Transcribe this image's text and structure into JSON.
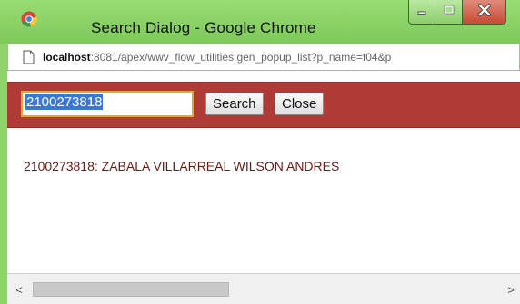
{
  "window": {
    "title": "Search Dialog - Google Chrome",
    "icon": "chrome-icon",
    "controls": {
      "minimize": "minimize-icon",
      "maximize": "maximize-icon",
      "close": "close-icon"
    },
    "frame_color": "#8fd46b"
  },
  "address_bar": {
    "host": "localhost",
    "rest": ":8081/apex/wwv_flow_utilities.gen_popup_list?p_name=f04&p"
  },
  "search": {
    "input_value": "2100273818",
    "search_label": "Search",
    "close_label": "Close",
    "bar_color": "#b03b36"
  },
  "results": [
    {
      "label": "2100273818: ZABALA VILLARREAL WILSON ANDRES"
    }
  ],
  "scrollbar": {
    "left_arrow": "<",
    "right_arrow": ">"
  }
}
